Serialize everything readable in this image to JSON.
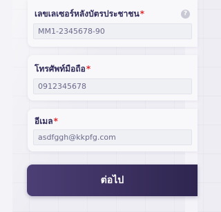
{
  "form": {
    "fields": [
      {
        "label": "เลขเลเซอร์หลังบัตรประชาชน",
        "required_mark": "*",
        "value": "MM1-2345678-90",
        "help_icon_glyph": "?"
      },
      {
        "label": "โทรศัพท์มือถือ",
        "required_mark": "*",
        "value": "0912345678"
      },
      {
        "label": "อีเมล",
        "required_mark": "*",
        "value": "asdfggh@kkpfg.com"
      }
    ],
    "next_button_label": "ต่อไป"
  },
  "colors": {
    "label": "#2e2a58",
    "required": "#e0282e",
    "button": "#3a2f5e"
  }
}
